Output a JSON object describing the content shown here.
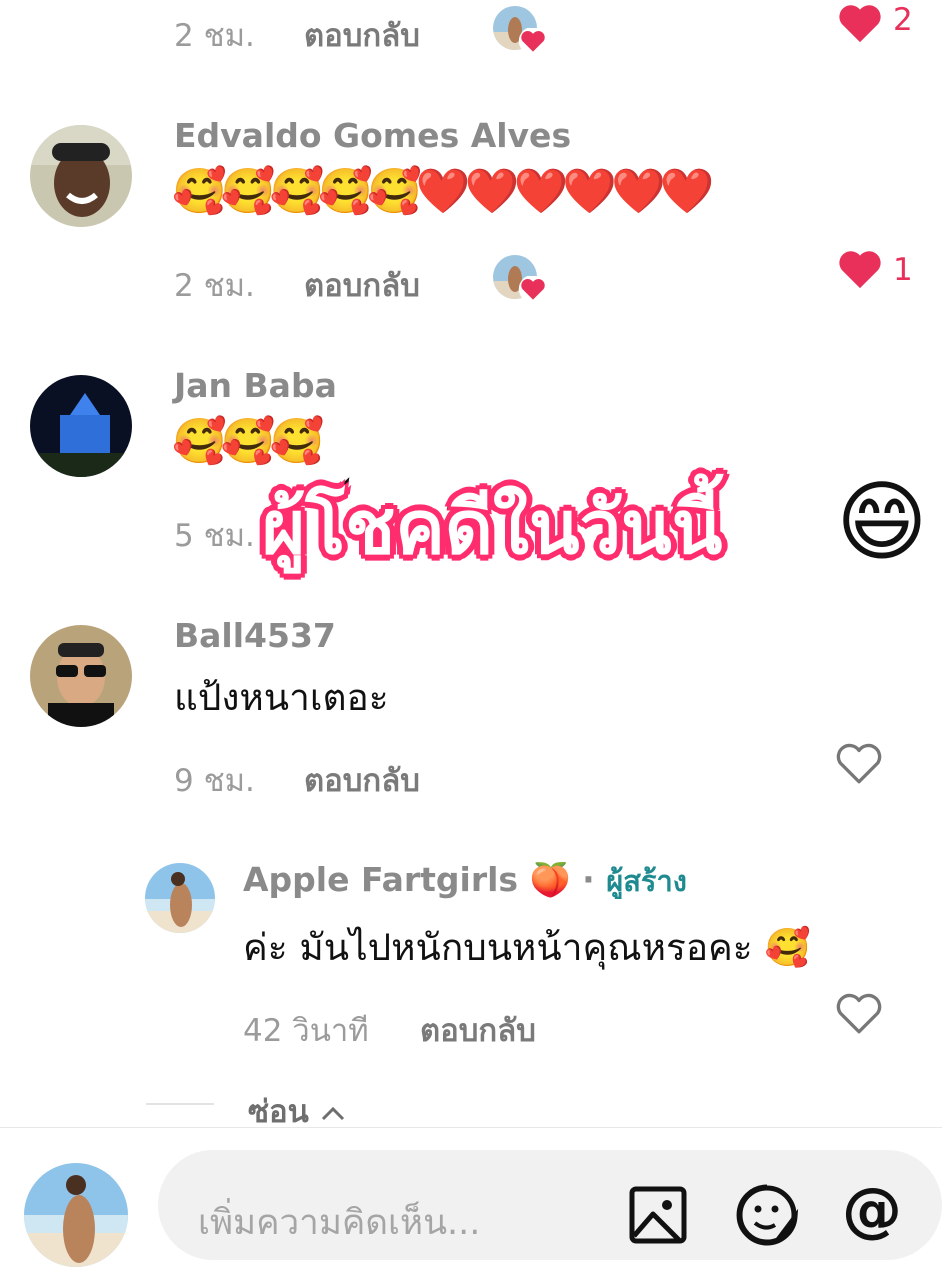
{
  "comments": [
    {
      "username": "",
      "text": "",
      "time": "2 ชม.",
      "reply_label": "ตอบกลับ",
      "likes": "2",
      "liked": true
    },
    {
      "username": "Edvaldo Gomes Alves",
      "text": "🥰🥰🥰🥰🥰❤️❤️❤️❤️❤️❤️",
      "time": "2 ชม.",
      "reply_label": "ตอบกลับ",
      "likes": "1",
      "liked": true
    },
    {
      "username": "Jan Baba",
      "text": "🥰🥰🥰",
      "time": "5 ชม.",
      "reply_label": "",
      "likes": "",
      "liked": false
    },
    {
      "username": "Ball4537",
      "text": "แป้งหนาเตอะ",
      "time": "9 ชม.",
      "reply_label": "ตอบกลับ",
      "likes": "",
      "liked": false
    }
  ],
  "reply": {
    "username": "Apple Fartgirls",
    "username_emoji": "🍑",
    "separator": "·",
    "creator_badge": "ผู้สร้าง",
    "text": "ค่ะ มันไปหนักบนหน้าคุณหรอคะ",
    "text_emoji": "🥰",
    "time": "42 วินาที",
    "reply_label": "ตอบกลับ"
  },
  "hide_replies_label": "ซ่อน",
  "overlay": {
    "text": "ผู้โชคดีในวันนี้",
    "emoji": "😄"
  },
  "composer": {
    "placeholder": "เพิ่มความคิดเห็น..."
  },
  "colors": {
    "like_red": "#e8305a",
    "creator_teal": "#1f8a8f",
    "overlay_outline": "#ff2d6e"
  },
  "icons": {
    "image": "image-icon",
    "emoji": "emoji-icon",
    "mention": "at-icon",
    "heart_filled": "heart-filled-icon",
    "heart_outline": "heart-outline-icon",
    "chevron_up": "chevron-up-icon"
  }
}
